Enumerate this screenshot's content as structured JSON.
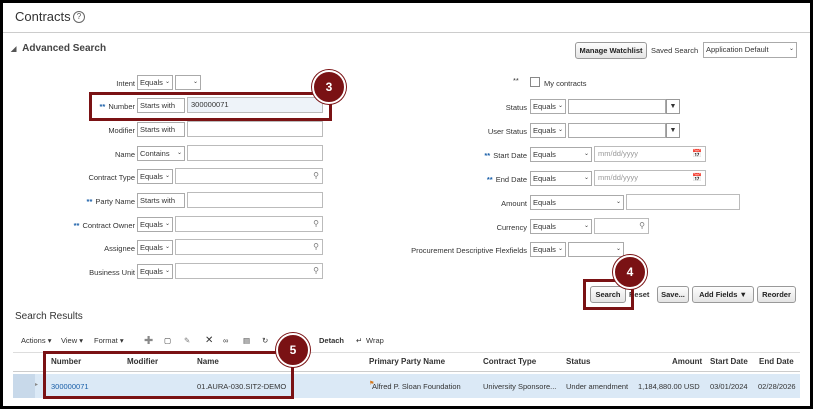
{
  "page": {
    "title": "Contracts",
    "help_icon": "?"
  },
  "search": {
    "section_title": "Advanced Search",
    "manage_watchlist": "Manage Watchlist",
    "saved_search_label": "Saved Search",
    "saved_search_value": "Application Default",
    "left_fields": [
      {
        "label": "Intent",
        "operator": "Equals",
        "required": false,
        "value": ""
      },
      {
        "label": "Number",
        "operator": "Starts with",
        "required": true,
        "value": "300000071"
      },
      {
        "label": "Modifier",
        "operator": "Starts with",
        "required": false,
        "value": ""
      },
      {
        "label": "Name",
        "operator": "Contains",
        "required": false,
        "value": ""
      },
      {
        "label": "Contract Type",
        "operator": "Equals",
        "required": false,
        "value": ""
      },
      {
        "label": "Party Name",
        "operator": "Starts with",
        "required": true,
        "value": ""
      },
      {
        "label": "Contract Owner",
        "operator": "Equals",
        "required": true,
        "value": ""
      },
      {
        "label": "Assignee",
        "operator": "Equals",
        "required": false,
        "value": ""
      },
      {
        "label": "Business Unit",
        "operator": "Equals",
        "required": false,
        "value": ""
      }
    ],
    "my_contracts_label": "My contracts",
    "right_fields": [
      {
        "label": "Status",
        "operator": "Equals",
        "required": false
      },
      {
        "label": "User Status",
        "operator": "Equals",
        "required": false
      },
      {
        "label": "Start Date",
        "operator": "Equals",
        "required": true,
        "placeholder": "mm/dd/yyyy"
      },
      {
        "label": "End Date",
        "operator": "Equals",
        "required": true,
        "placeholder": "mm/dd/yyyy"
      },
      {
        "label": "Amount",
        "operator": "Equals",
        "required": false
      },
      {
        "label": "Currency",
        "operator": "Equals",
        "required": false
      },
      {
        "label": "Procurement Descriptive Flexfields",
        "operator": "Equals",
        "required": false
      }
    ],
    "required_marker": "**",
    "buttons": {
      "search": "Search",
      "reset": "Reset",
      "save": "Save...",
      "add_fields": "Add Fields",
      "reorder": "Reorder"
    }
  },
  "results": {
    "title": "Search Results",
    "toolbar": {
      "actions": "Actions",
      "view": "View",
      "format": "Format",
      "detach": "Detach",
      "wrap": "Wrap"
    },
    "columns": [
      "Number",
      "Modifier",
      "Name",
      "Primary Party Name",
      "Contract Type",
      "Status",
      "Amount",
      "Start Date",
      "End Date"
    ],
    "row": {
      "number": "300000071",
      "modifier": "",
      "name": "01.AURA-030.SIT2-DEMO",
      "party": "Alfred P. Sloan Foundation",
      "type": "University Sponsore...",
      "status": "Under amendment",
      "amount": "1,184,880.00",
      "currency": "USD",
      "start": "03/01/2024",
      "end": "02/28/2026"
    }
  },
  "callouts": [
    "3",
    "4",
    "5"
  ],
  "colors": {
    "callout": "#7a1214",
    "required": "#1a5fa8",
    "row_highlight": "#dbe9f6"
  }
}
